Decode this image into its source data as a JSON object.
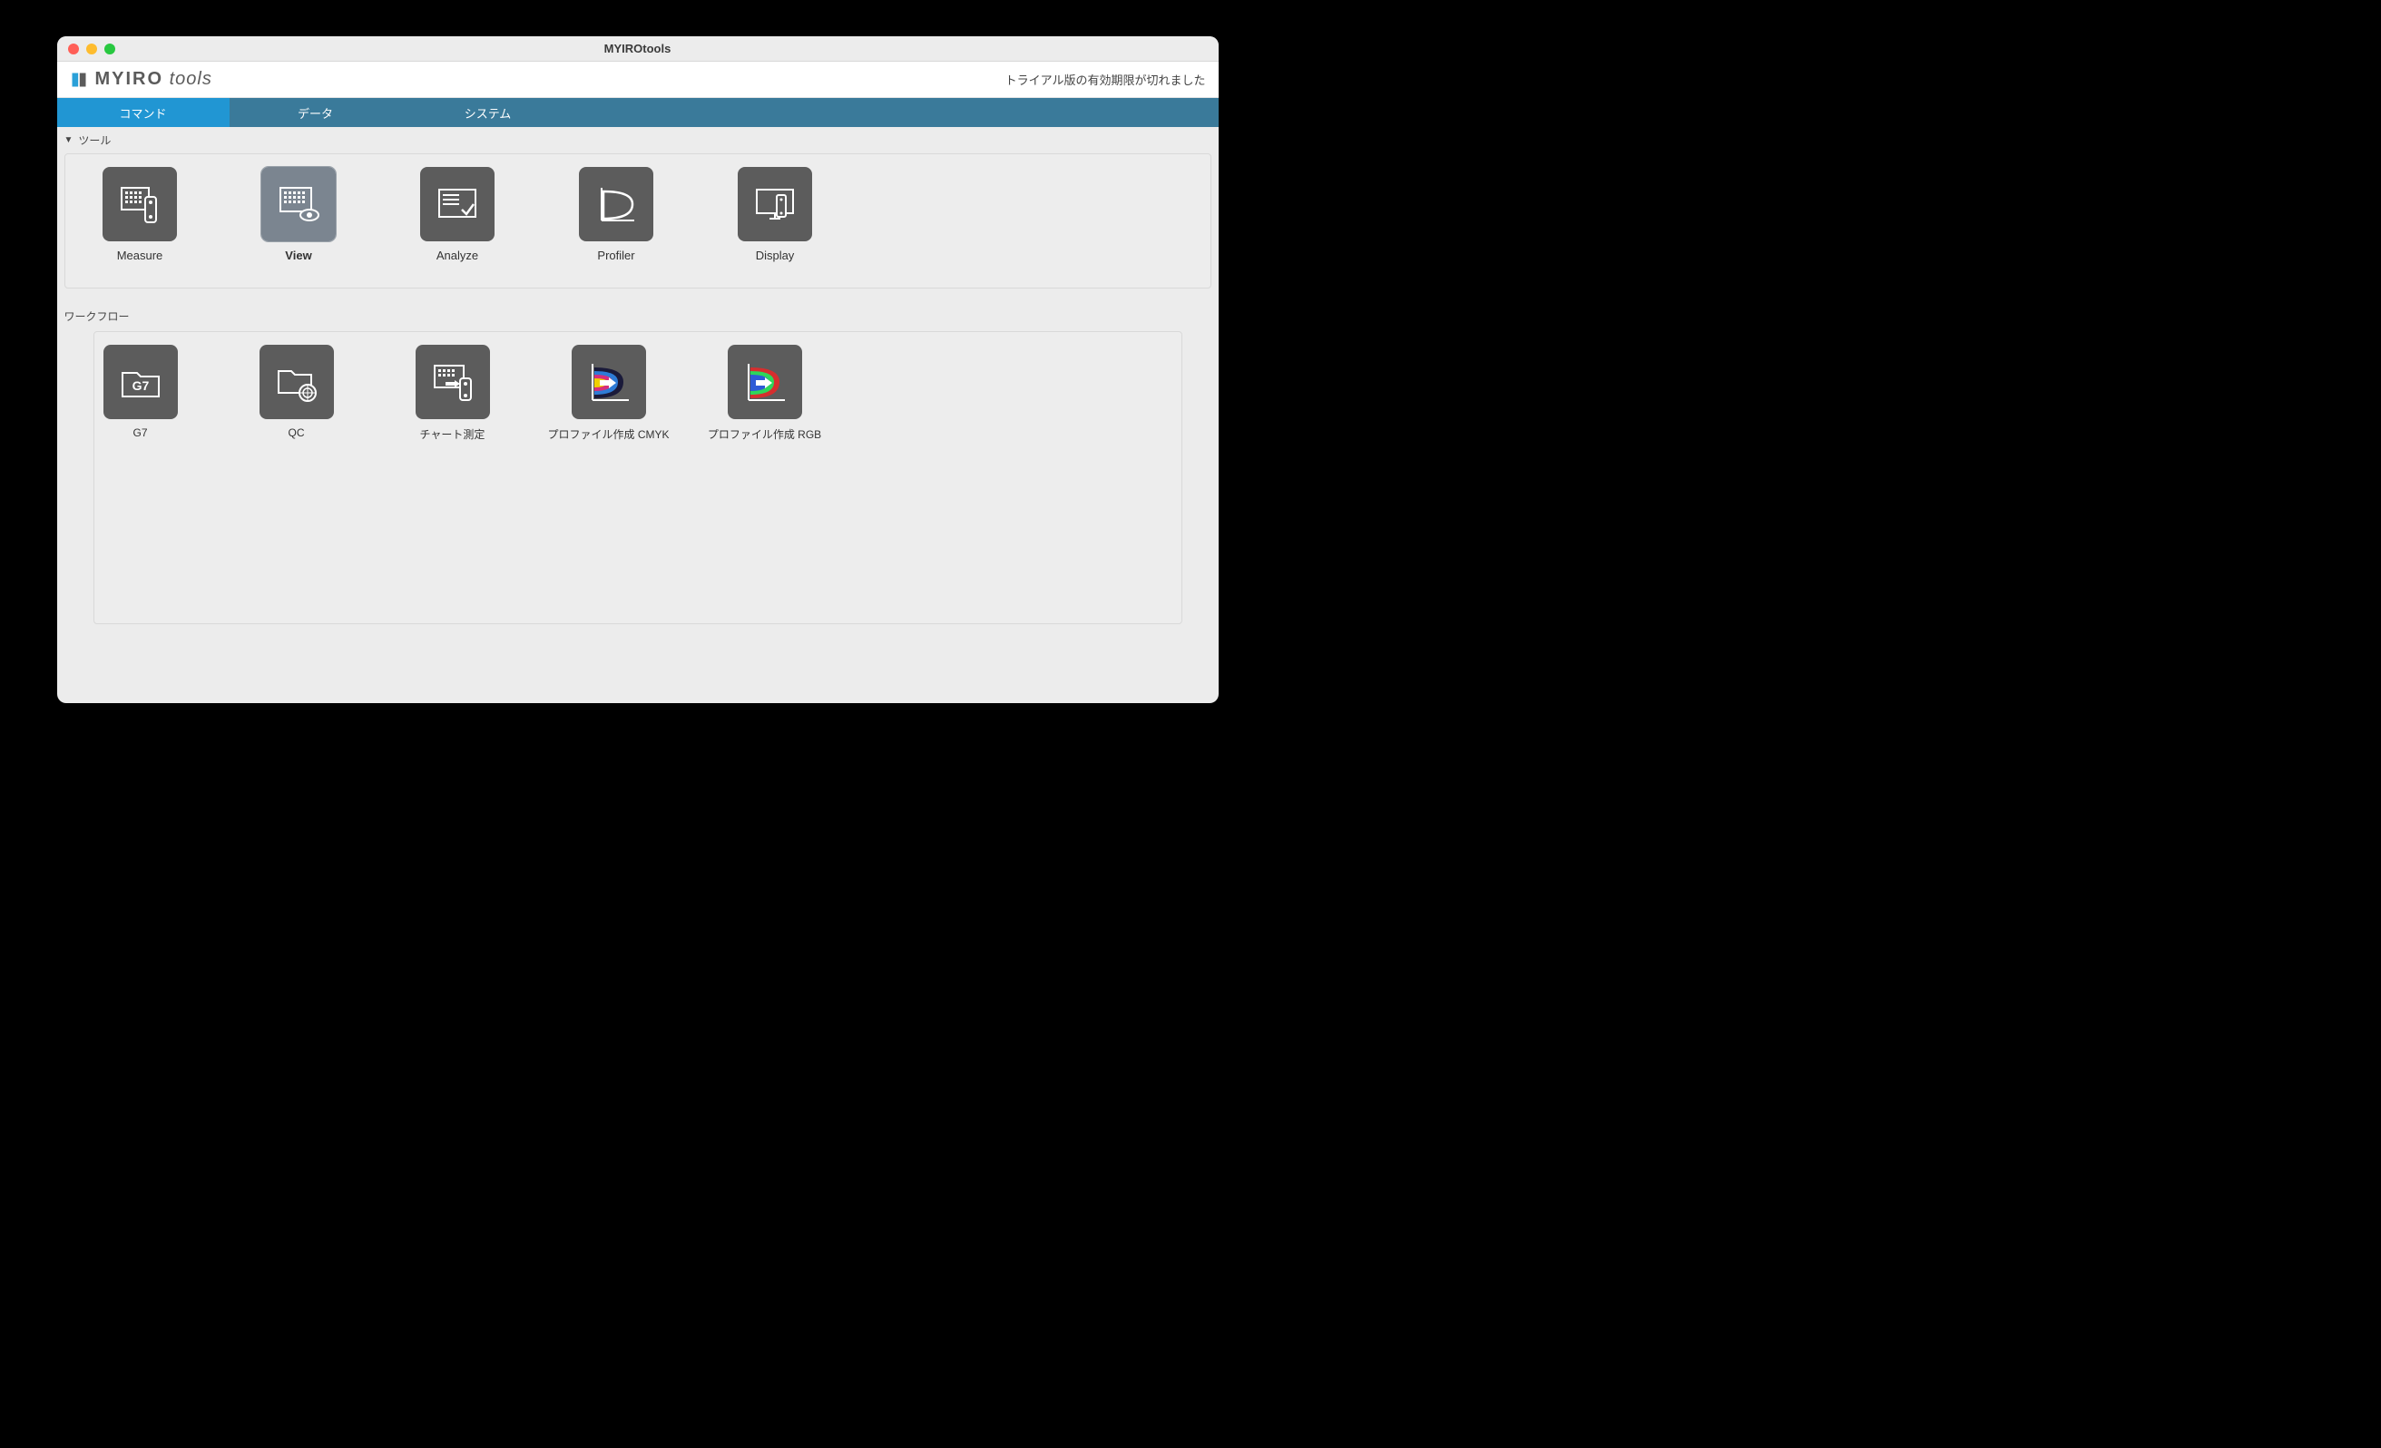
{
  "window": {
    "title": "MYIROtools"
  },
  "brand": {
    "name_bold": "MYIRO",
    "name_sub": "tools",
    "trial_text": "トライアル版の有効期限が切れました"
  },
  "tabs": {
    "command": "コマンド",
    "data": "データ",
    "system": "システム"
  },
  "sections": {
    "tools": "ツール",
    "workflow": "ワークフロー"
  },
  "tools": {
    "measure": "Measure",
    "view": "View",
    "analyze": "Analyze",
    "profiler": "Profiler",
    "display": "Display"
  },
  "workflows": {
    "g7": "G7",
    "qc": "QC",
    "chart_measure": "チャート測定",
    "profile_cmyk": "プロファイル作成 CMYK",
    "profile_rgb": "プロファイル作成 RGB"
  }
}
